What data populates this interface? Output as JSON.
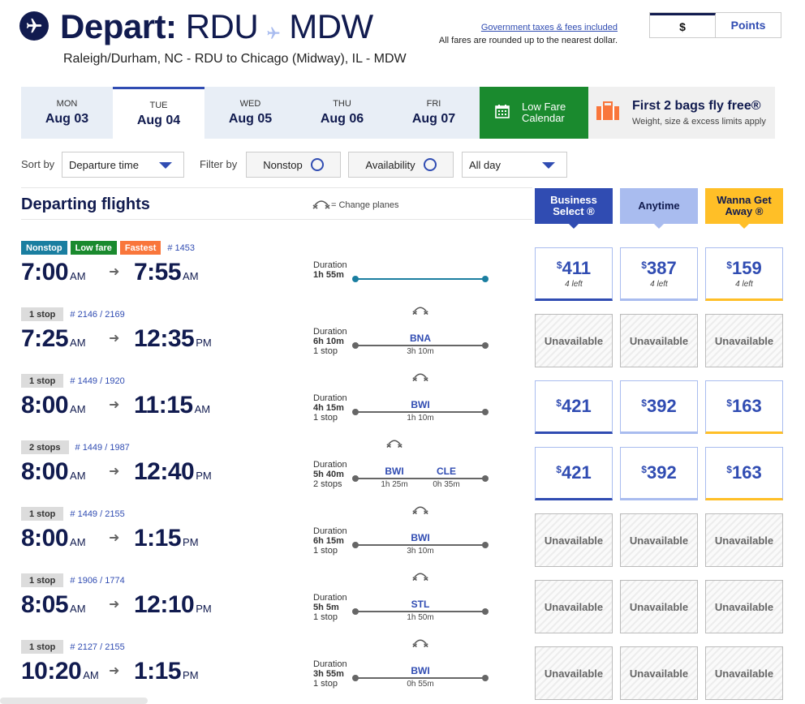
{
  "header": {
    "title_prefix": "Depart:",
    "origin": "RDU",
    "destination": "MDW",
    "subtitle": "Raleigh/Durham, NC - RDU to Chicago (Midway), IL - MDW",
    "taxes_link": "Government taxes & fees included",
    "rounding_note": "All fares are rounded up to the nearest dollar.",
    "currency_toggle": {
      "dollars": "$",
      "points": "Points",
      "selected": "dollars"
    }
  },
  "date_tabs": [
    {
      "dow": "MON",
      "date": "Aug 03",
      "selected": false
    },
    {
      "dow": "TUE",
      "date": "Aug 04",
      "selected": true
    },
    {
      "dow": "WED",
      "date": "Aug 05",
      "selected": false
    },
    {
      "dow": "THU",
      "date": "Aug 06",
      "selected": false
    },
    {
      "dow": "FRI",
      "date": "Aug 07",
      "selected": false
    }
  ],
  "low_fare_calendar": {
    "line1": "Low Fare",
    "line2": "Calendar"
  },
  "bags_promo": {
    "title": "First 2 bags fly free®",
    "note": "Weight, size & excess limits apply"
  },
  "filters": {
    "sort_label": "Sort by",
    "sort_value": "Departure time",
    "filter_label": "Filter by",
    "nonstop": "Nonstop",
    "availability": "Availability",
    "time_value": "All day"
  },
  "section": {
    "title": "Departing flights",
    "change_planes": "= Change planes"
  },
  "fare_columns": {
    "business": "Business Select ®",
    "anytime": "Anytime",
    "wga": "Wanna Get Away ®"
  },
  "colors": {
    "navy": "#111b4f",
    "blue": "#304cb2",
    "lightblue": "#a9bcef",
    "yellow": "#ffbf27",
    "green": "#1a8a2e",
    "orange": "#f9763b",
    "teal": "#1a7ea0"
  },
  "flights": [
    {
      "badges": [
        "Nonstop",
        "Low fare",
        "Fastest"
      ],
      "flight_nums": "# 1453",
      "depart": "7:00",
      "depart_ap": "AM",
      "arrive": "7:55",
      "arrive_ap": "AM",
      "duration_label": "Duration",
      "duration": "1h 55m",
      "stops_text": "",
      "stops": [],
      "fares": [
        {
          "price": "411",
          "left": "4 left"
        },
        {
          "price": "387",
          "left": "4 left"
        },
        {
          "price": "159",
          "left": "4 left"
        }
      ]
    },
    {
      "badges": [
        "1 stop"
      ],
      "flight_nums": "# 2146 / 2169",
      "depart": "7:25",
      "depart_ap": "AM",
      "arrive": "12:35",
      "arrive_ap": "PM",
      "duration_label": "Duration",
      "duration": "6h 10m",
      "stops_text": "1 stop",
      "stops": [
        {
          "code": "BNA",
          "layover": "3h 10m",
          "change": true
        }
      ],
      "fares": [
        {
          "unavailable": "Unavailable"
        },
        {
          "unavailable": "Unavailable"
        },
        {
          "unavailable": "Unavailable"
        }
      ]
    },
    {
      "badges": [
        "1 stop"
      ],
      "flight_nums": "# 1449 / 1920",
      "depart": "8:00",
      "depart_ap": "AM",
      "arrive": "11:15",
      "arrive_ap": "AM",
      "duration_label": "Duration",
      "duration": "4h 15m",
      "stops_text": "1 stop",
      "stops": [
        {
          "code": "BWI",
          "layover": "1h 10m",
          "change": true
        }
      ],
      "fares": [
        {
          "price": "421"
        },
        {
          "price": "392"
        },
        {
          "price": "163"
        }
      ]
    },
    {
      "badges": [
        "2 stops"
      ],
      "flight_nums": "# 1449 / 1987",
      "depart": "8:00",
      "depart_ap": "AM",
      "arrive": "12:40",
      "arrive_ap": "PM",
      "duration_label": "Duration",
      "duration": "5h 40m",
      "stops_text": "2 stops",
      "stops": [
        {
          "code": "BWI",
          "layover": "1h 25m",
          "change": true
        },
        {
          "code": "CLE",
          "layover": "0h 35m",
          "change": false
        }
      ],
      "fares": [
        {
          "price": "421"
        },
        {
          "price": "392"
        },
        {
          "price": "163"
        }
      ]
    },
    {
      "badges": [
        "1 stop"
      ],
      "flight_nums": "# 1449 / 2155",
      "depart": "8:00",
      "depart_ap": "AM",
      "arrive": "1:15",
      "arrive_ap": "PM",
      "duration_label": "Duration",
      "duration": "6h 15m",
      "stops_text": "1 stop",
      "stops": [
        {
          "code": "BWI",
          "layover": "3h 10m",
          "change": true
        }
      ],
      "fares": [
        {
          "unavailable": "Unavailable"
        },
        {
          "unavailable": "Unavailable"
        },
        {
          "unavailable": "Unavailable"
        }
      ]
    },
    {
      "badges": [
        "1 stop"
      ],
      "flight_nums": "# 1906 / 1774",
      "depart": "8:05",
      "depart_ap": "AM",
      "arrive": "12:10",
      "arrive_ap": "PM",
      "duration_label": "Duration",
      "duration": "5h 5m",
      "stops_text": "1 stop",
      "stops": [
        {
          "code": "STL",
          "layover": "1h 50m",
          "change": true
        }
      ],
      "fares": [
        {
          "unavailable": "Unavailable"
        },
        {
          "unavailable": "Unavailable"
        },
        {
          "unavailable": "Unavailable"
        }
      ]
    },
    {
      "badges": [
        "1 stop"
      ],
      "flight_nums": "# 2127 / 2155",
      "depart": "10:20",
      "depart_ap": "AM",
      "arrive": "1:15",
      "arrive_ap": "PM",
      "duration_label": "Duration",
      "duration": "3h 55m",
      "stops_text": "1 stop",
      "stops": [
        {
          "code": "BWI",
          "layover": "0h 55m",
          "change": true
        }
      ],
      "fares": [
        {
          "unavailable": "Unavailable"
        },
        {
          "unavailable": "Unavailable"
        },
        {
          "unavailable": "Unavailable"
        }
      ]
    }
  ]
}
